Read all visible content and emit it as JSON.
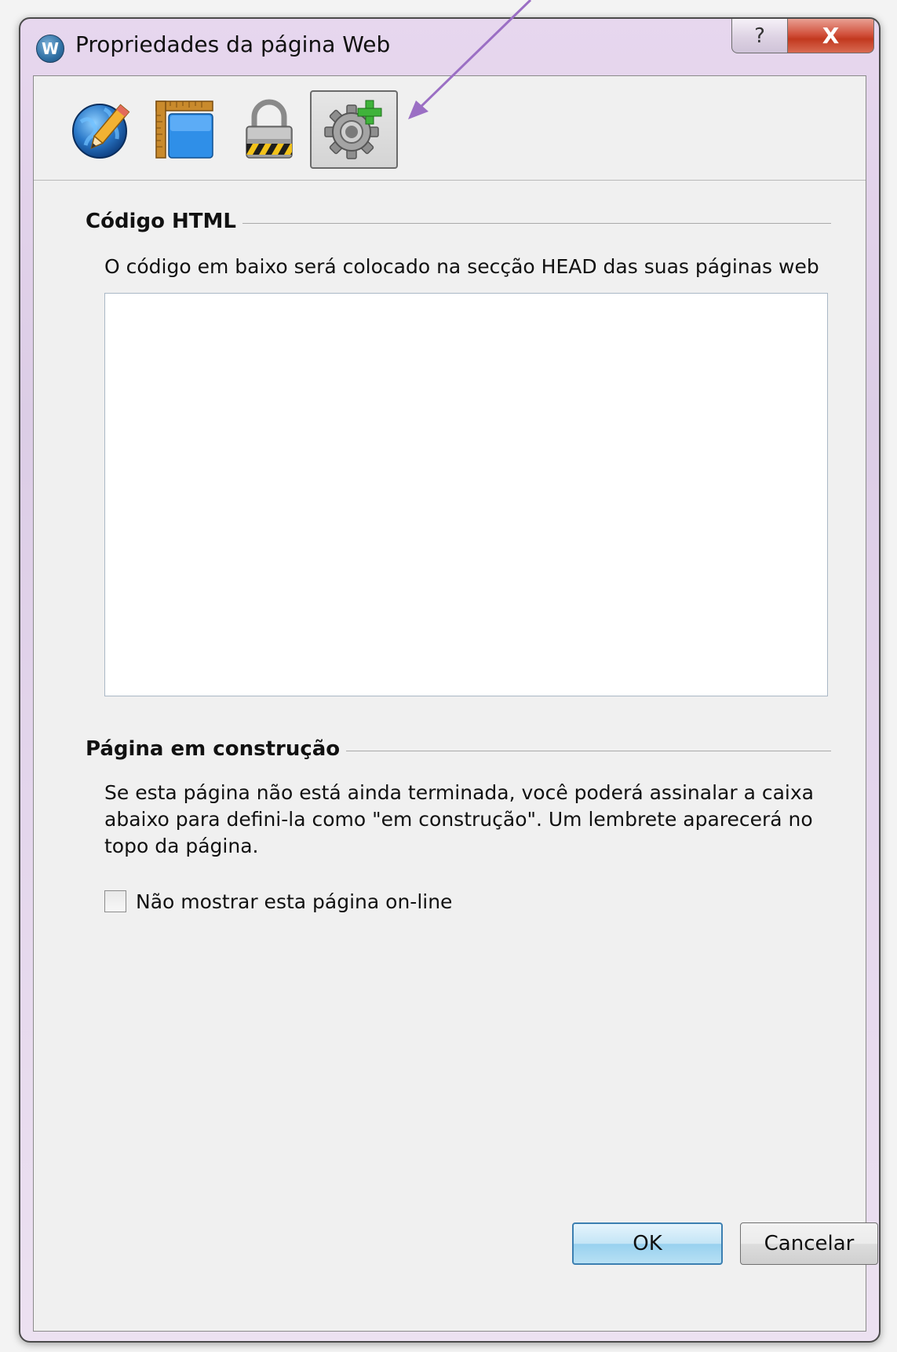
{
  "window": {
    "title": "Propriedades da página Web",
    "app_icon_letter": "W",
    "help_glyph": "?",
    "close_glyph": "X"
  },
  "toolbar": {
    "tools": [
      {
        "icon": "globe-pencil-icon",
        "active": false
      },
      {
        "icon": "page-layout-icon",
        "active": false
      },
      {
        "icon": "padlock-icon",
        "active": false
      },
      {
        "icon": "gear-plus-icon",
        "active": true
      }
    ]
  },
  "html_code": {
    "group_title": "Código HTML",
    "description": "O código em baixo será colocado na secção HEAD das suas páginas web",
    "value": ""
  },
  "under_construction": {
    "group_title": "Página em construção",
    "description": "Se esta página não está ainda terminada, você poderá assinalar a caixa abaixo para defini-la como \"em construção\". Um lembrete aparecerá no topo da página.",
    "checkbox_label": "Não mostrar esta página on-line",
    "checked": false
  },
  "buttons": {
    "ok_label": "OK",
    "cancel_label": "Cancelar"
  },
  "colors": {
    "annotation_arrow": "#9b6fc4",
    "ok_border": "#3c7fb1",
    "close_button": "#c2391f"
  }
}
